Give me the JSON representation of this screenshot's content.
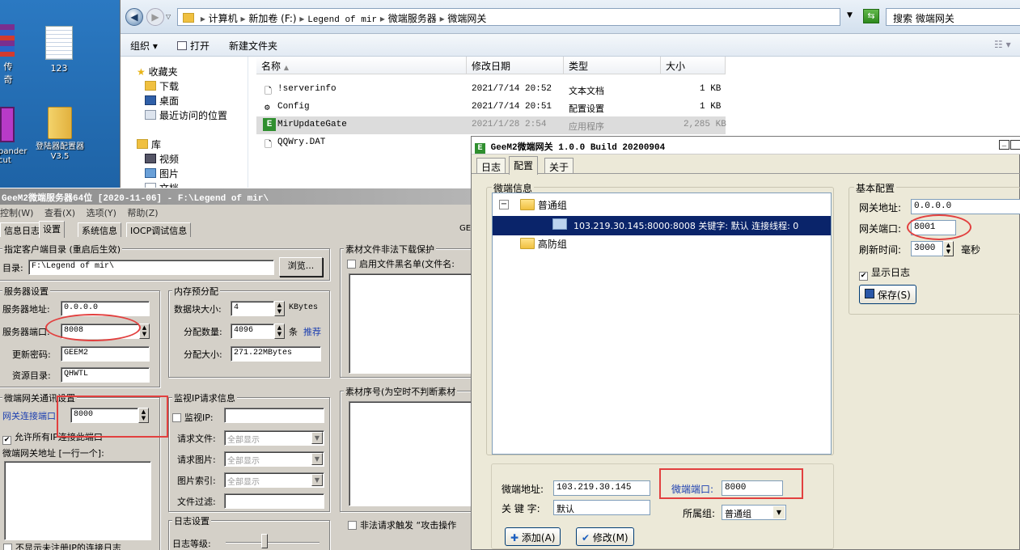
{
  "desktop": {
    "icons": [
      {
        "label": "传奇"
      },
      {
        "label": "123"
      },
      {
        "label": "pander\ncut"
      },
      {
        "label": "登陆器配置器\nV3.5"
      }
    ]
  },
  "explorer": {
    "breadcrumb": [
      "计算机",
      "新加卷 (F:)",
      "Legend of mir",
      "微端服务器",
      "微端网关"
    ],
    "search_placeholder": "搜索 微端网关",
    "toolbar": {
      "organize": "组织 ▾",
      "open": "打开",
      "new_folder": "新建文件夹"
    },
    "nav": {
      "favorites": "收藏夹",
      "downloads": "下载",
      "desktop": "桌面",
      "recent": "最近访问的位置",
      "libraries": "库",
      "videos": "视频",
      "pictures": "图片",
      "docs": "文档"
    },
    "columns": {
      "name": "名称",
      "modified": "修改日期",
      "type": "类型",
      "size": "大小"
    },
    "files": [
      {
        "name": "!serverinfo",
        "modified": "2021/7/14 20:52",
        "type": "文本文档",
        "size": "1 KB"
      },
      {
        "name": "Config",
        "modified": "2021/7/14 20:51",
        "type": "配置设置",
        "size": "1 KB"
      },
      {
        "name": "MirUpdateGate",
        "modified": "2021/1/28 2:54",
        "type": "应用程序",
        "size": "2,285 KB"
      },
      {
        "name": "QQWry.DAT",
        "modified": "",
        "type": "",
        "size": ""
      }
    ]
  },
  "server": {
    "title": "GeeM2微端服务器64位 [2020-11-06] - F:\\Legend of mir\\",
    "menu": [
      "控制(W)",
      "查看(X)",
      "选项(Y)",
      "帮助(Z)"
    ],
    "tabs": [
      "信息日志",
      "设置",
      "系统信息",
      "IOCP调试信息"
    ],
    "status_fragment": "GE",
    "client_dir": {
      "legend": "指定客户端目录 (重启后生效)",
      "label": "目录:",
      "value": "F:\\Legend of mir\\",
      "browse": "浏览..."
    },
    "server_settings": {
      "legend": "服务器设置",
      "addr_label": "服务器地址:",
      "addr": "0.0.0.0",
      "port_label": "服务器端口:",
      "port": "8008",
      "pwd_label": "更新密码:",
      "pwd": "GEEM2",
      "res_label": "资源目录:",
      "res": "QHWTL"
    },
    "memory": {
      "legend": "内存预分配",
      "block_label": "数据块大小:",
      "block": "4",
      "block_unit": "KBytes",
      "count_label": "分配数量:",
      "count": "4096",
      "count_unit": "条",
      "recommend": "推荐",
      "size_label": "分配大小:",
      "size": "271.22MBytes"
    },
    "gate_comm": {
      "legend": "微端网关通讯设置",
      "port_label": "网关连接端口:",
      "port": "8000",
      "allow_label": "允许所有IP连接此端口",
      "addr_label": "微端网关地址 [一行一个]:"
    },
    "monitor": {
      "legend": "监视IP请求信息",
      "ip_label": "监视IP:",
      "req_file_label": "请求文件:",
      "req_file": "全部显示",
      "req_img_label": "请求图片:",
      "req_img": "全部显示",
      "img_idx_label": "图片索引:",
      "img_idx": "全部显示",
      "file_filter_label": "文件过滤:"
    },
    "log": {
      "legend": "日志设置",
      "level_label": "日志等级:"
    },
    "material": {
      "legend": "素材文件非法下载保护",
      "blacklist_label": "启用文件黑名单(文件名:",
      "seq_legend": "素材序号(为空时不判断素材",
      "illegal_label": "非法请求触发 “攻击操作"
    },
    "bottom_check": "不显示未注册IP的连接日志"
  },
  "gate": {
    "title": "GeeM2微端网关 1.0.0 Build 20200904",
    "tabs": [
      "日志",
      "配置",
      "关于"
    ],
    "info": {
      "legend": "微端信息",
      "group_normal": "普通组",
      "server_entry": "103.219.30.145:8000:8008 关键字: 默认 连接线程: 0",
      "group_defense": "高防组"
    },
    "form": {
      "addr_label": "微端地址:",
      "addr": "103.219.30.145",
      "port_label": "微端端口:",
      "port": "8000",
      "key_label": "关 键 字:",
      "key": "默认",
      "group_label": "所属组:",
      "group": "普通组",
      "add": "添加(A)",
      "modify": "修改(M)"
    },
    "basic": {
      "legend": "基本配置",
      "addr_label": "网关地址:",
      "addr": "0.0.0.0",
      "port_label": "网关端口:",
      "port": "8001",
      "refresh_label": "刷新时间:",
      "refresh": "3000",
      "refresh_unit": "毫秒",
      "showlog_label": "显示日志",
      "save": "保存(S)"
    }
  }
}
